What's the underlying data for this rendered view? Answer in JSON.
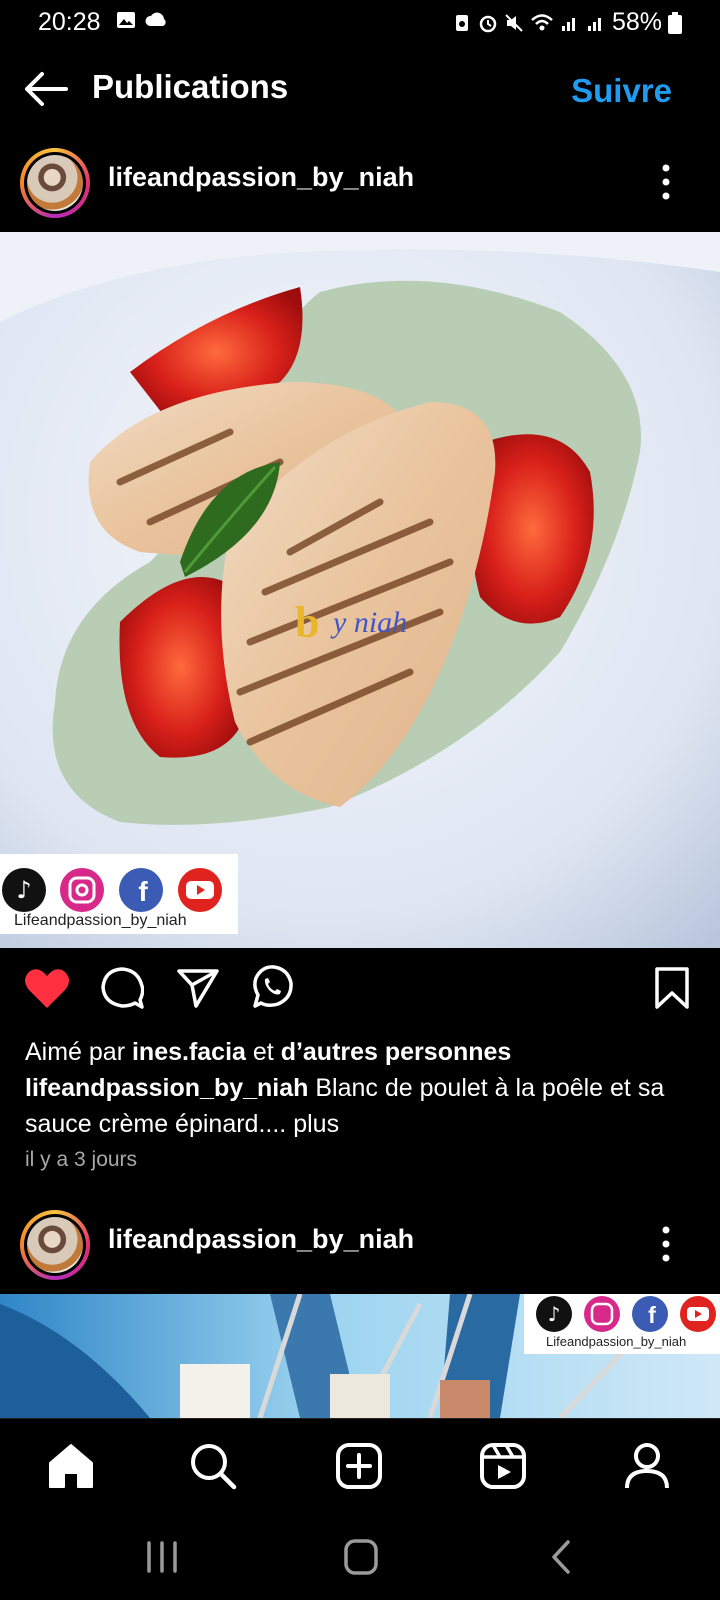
{
  "status": {
    "time": "20:28",
    "battery": "58%"
  },
  "header": {
    "title": "Publications",
    "follow_label": "Suivre"
  },
  "post1": {
    "username": "lifeandpassion_by_niah",
    "watermark": "by niah",
    "social_badge_text": "Lifeandpassion_by_niah",
    "liked_prefix": "Aimé par ",
    "liked_user": "ines.facia",
    "liked_middle": " et ",
    "liked_others": "d’autres personnes",
    "caption_user": "lifeandpassion_by_niah",
    "caption_text": " Blanc de poulet à la poêle et sa sauce crème épinard.... ",
    "caption_more": "plus",
    "time_ago": "il y a 3 jours"
  },
  "post2": {
    "username": "lifeandpassion_by_niah",
    "social_badge_text": "Lifeandpassion_by_niah"
  },
  "colors": {
    "accent": "#1f9bf0",
    "like": "#ff3040",
    "background": "#000000"
  },
  "icons": [
    "back-arrow-icon",
    "more-icon",
    "heart-icon",
    "comment-icon",
    "share-icon",
    "whatsapp-icon",
    "bookmark-icon",
    "home-icon",
    "search-icon",
    "add-icon",
    "reels-icon",
    "profile-icon"
  ]
}
